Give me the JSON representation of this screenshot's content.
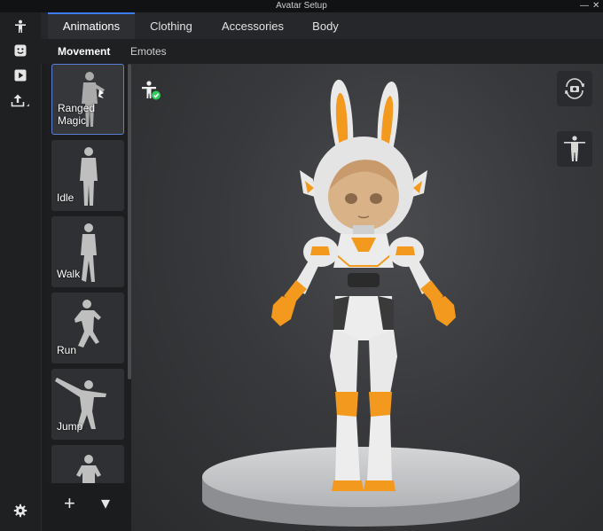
{
  "window": {
    "title": "Avatar Setup",
    "minimize_glyph": "—",
    "close_glyph": "✕"
  },
  "left_rail": [
    {
      "name": "avatar-person-icon"
    },
    {
      "name": "face-icon"
    },
    {
      "name": "play-icon"
    },
    {
      "name": "upload-icon"
    },
    {
      "name": "gear-icon"
    }
  ],
  "tabs": [
    {
      "label": "Animations",
      "active": true
    },
    {
      "label": "Clothing",
      "active": false
    },
    {
      "label": "Accessories",
      "active": false
    },
    {
      "label": "Body",
      "active": false
    }
  ],
  "subtabs": [
    {
      "label": "Movement",
      "active": true
    },
    {
      "label": "Emotes",
      "active": false
    }
  ],
  "animation_cards": [
    {
      "label": "Ranged Magic",
      "selected": true
    },
    {
      "label": "Idle",
      "selected": false
    },
    {
      "label": "Walk",
      "selected": false
    },
    {
      "label": "Run",
      "selected": false
    },
    {
      "label": "Jump",
      "selected": false
    },
    {
      "label": "",
      "selected": false
    }
  ],
  "list_footer": {
    "add_glyph": "+",
    "dropdown_glyph": "▾"
  },
  "colors": {
    "accent": "#3b7cf0",
    "status_ok": "#2ecc5a",
    "suit_orange": "#f39a1e",
    "suit_white": "#e9e9e9"
  }
}
